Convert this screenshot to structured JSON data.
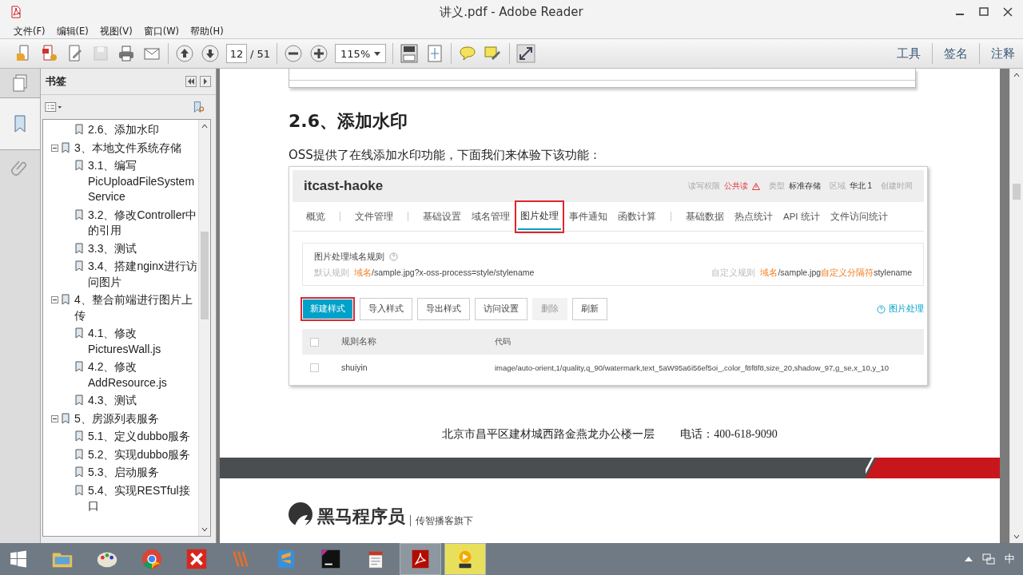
{
  "window": {
    "title": "讲义.pdf - Adobe Reader"
  },
  "menu": [
    "文件(F)",
    "编辑(E)",
    "视图(V)",
    "窗口(W)",
    "帮助(H)"
  ],
  "toolbar": {
    "save_enabled": false,
    "page": "12",
    "page_count": "/ 51",
    "zoom": "115%",
    "panels": [
      "工具",
      "签名",
      "注释"
    ]
  },
  "bookmarks": {
    "title": "书签",
    "continued": [
      {
        "label": "2.6、添加水印"
      }
    ],
    "items": [
      {
        "label": "3、本地文件系统存储",
        "expanded": true,
        "children": [
          {
            "label": "3.1、编写PicUploadFileSystemService"
          },
          {
            "label": "3.2、修改Controller中的引用"
          },
          {
            "label": "3.3、测试"
          },
          {
            "label": "3.4、搭建nginx进行访问图片"
          }
        ]
      },
      {
        "label": "4、整合前端进行图片上传",
        "expanded": true,
        "children": [
          {
            "label": "4.1、修改PicturesWall.js"
          },
          {
            "label": "4.2、修改AddResource.js"
          },
          {
            "label": "4.3、测试"
          }
        ]
      },
      {
        "label": "5、房源列表服务",
        "expanded": true,
        "children": [
          {
            "label": "5.1、定义dubbo服务"
          },
          {
            "label": "5.2、实现dubbo服务"
          },
          {
            "label": "5.3、启动服务"
          },
          {
            "label": "5.4、实现RESTful接口"
          }
        ]
      }
    ]
  },
  "document": {
    "heading": "2.6、添加水印",
    "paragraph": "OSS提供了在线添加水印功能，下面我们来体验下该功能：",
    "screenshot": {
      "bucket": "itcast-haoke",
      "meta": [
        {
          "label": "读写权限",
          "value": "公共读",
          "kind": "warning"
        },
        {
          "label": "类型",
          "value": "标准存储",
          "kind": "plain"
        },
        {
          "label": "区域",
          "value": "华北 1",
          "kind": "plain"
        },
        {
          "label": "创建时间",
          "kind": "plain"
        }
      ],
      "tab_groups": [
        [
          {
            "label": "概览",
            "selected": false
          }
        ],
        [
          {
            "label": "文件管理",
            "selected": false
          }
        ],
        [
          {
            "label": "基础设置",
            "selected": false
          },
          {
            "label": "域名管理",
            "selected": false
          },
          {
            "label": "图片处理",
            "selected": true
          },
          {
            "label": "事件通知",
            "selected": false
          },
          {
            "label": "函数计算",
            "selected": false
          }
        ],
        [
          {
            "label": "基础数据",
            "selected": false
          },
          {
            "label": "热点统计",
            "selected": false
          },
          {
            "label": "API 统计",
            "selected": false
          },
          {
            "label": "文件访问统计",
            "selected": false
          }
        ]
      ],
      "rules": {
        "title": "图片处理域名规则",
        "default": {
          "label": "默认规则",
          "parts": [
            {
              "text": "域名",
              "kind": "accent"
            },
            {
              "text": "/sample.jpg?x-oss-process=style/stylename",
              "kind": "plain"
            }
          ]
        },
        "custom": {
          "label": "自定义规则",
          "parts": [
            {
              "text": "域名",
              "kind": "accent"
            },
            {
              "text": "/sample.jpg",
              "kind": "plain"
            },
            {
              "text": "自定义分隔符",
              "kind": "accent"
            },
            {
              "text": "stylename",
              "kind": "plain"
            }
          ]
        }
      },
      "buttons": [
        {
          "label": "新建样式",
          "kind": "primary",
          "disabled": false,
          "highlighted": true
        },
        {
          "label": "导入样式",
          "kind": "default",
          "disabled": false,
          "highlighted": false
        },
        {
          "label": "导出样式",
          "kind": "default",
          "disabled": false,
          "highlighted": false
        },
        {
          "label": "访问设置",
          "kind": "default",
          "disabled": false,
          "highlighted": false
        },
        {
          "label": "删除",
          "kind": "default",
          "disabled": true,
          "highlighted": false
        },
        {
          "label": "刷新",
          "kind": "default",
          "disabled": false,
          "highlighted": false
        }
      ],
      "help_link": "图片处理",
      "table": {
        "columns": [
          "规则名称",
          "代码"
        ],
        "all_checked": false,
        "rows": [
          {
            "checked": false,
            "name": "shuiyin",
            "code": "image/auto-orient,1/quality,q_90/watermark,text_5aW95a6i56ef5oi_,color_f8f8f8,size_20,shadow_97,g_se,x_10,y_10"
          }
        ]
      }
    },
    "address": "北京市昌平区建材城西路金燕龙办公楼一层",
    "phone": "电话：400-618-9090",
    "logo": {
      "name": "黑马程序员",
      "tagline": "传智播客旗下"
    }
  },
  "taskbar": {
    "apps": [
      {
        "kind": "folder",
        "active": false
      },
      {
        "kind": "paint",
        "active": false
      },
      {
        "kind": "chrome",
        "active": false
      },
      {
        "kind": "xmind",
        "active": false
      },
      {
        "kind": "stripes",
        "active": false
      },
      {
        "kind": "sublime",
        "active": false
      },
      {
        "kind": "intellij",
        "active": false
      },
      {
        "kind": "notepad",
        "active": false
      },
      {
        "kind": "pdf",
        "active": true
      },
      {
        "kind": "player",
        "active": true
      }
    ],
    "ime": "中"
  }
}
